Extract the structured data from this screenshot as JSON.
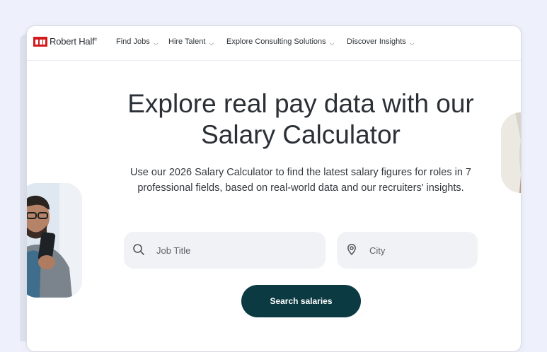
{
  "brand": {
    "name": "Robert Half",
    "trademark": "®"
  },
  "nav": {
    "items": [
      {
        "label": "Find Jobs"
      },
      {
        "label": "Hire Talent"
      },
      {
        "label": "Explore Consulting Solutions"
      },
      {
        "label": "Discover Insights"
      }
    ]
  },
  "hero": {
    "title_line1": "Explore real pay data with our",
    "title_line2": "Salary Calculator",
    "subtitle": "Use our 2026 Salary Calculator to find the latest salary figures for roles in 7 professional fields, based on real-world data and our recruiters' insights."
  },
  "search": {
    "job_placeholder": "Job Title",
    "city_placeholder": "City",
    "button_label": "Search salaries"
  },
  "colors": {
    "brand_red": "#d11a1a",
    "button_bg": "#0b3a42",
    "page_bg": "#eef1fb"
  },
  "icons": {
    "job_field": "search-icon",
    "city_field": "location-pin-icon",
    "nav_dropdown": "chevron-down-icon"
  }
}
